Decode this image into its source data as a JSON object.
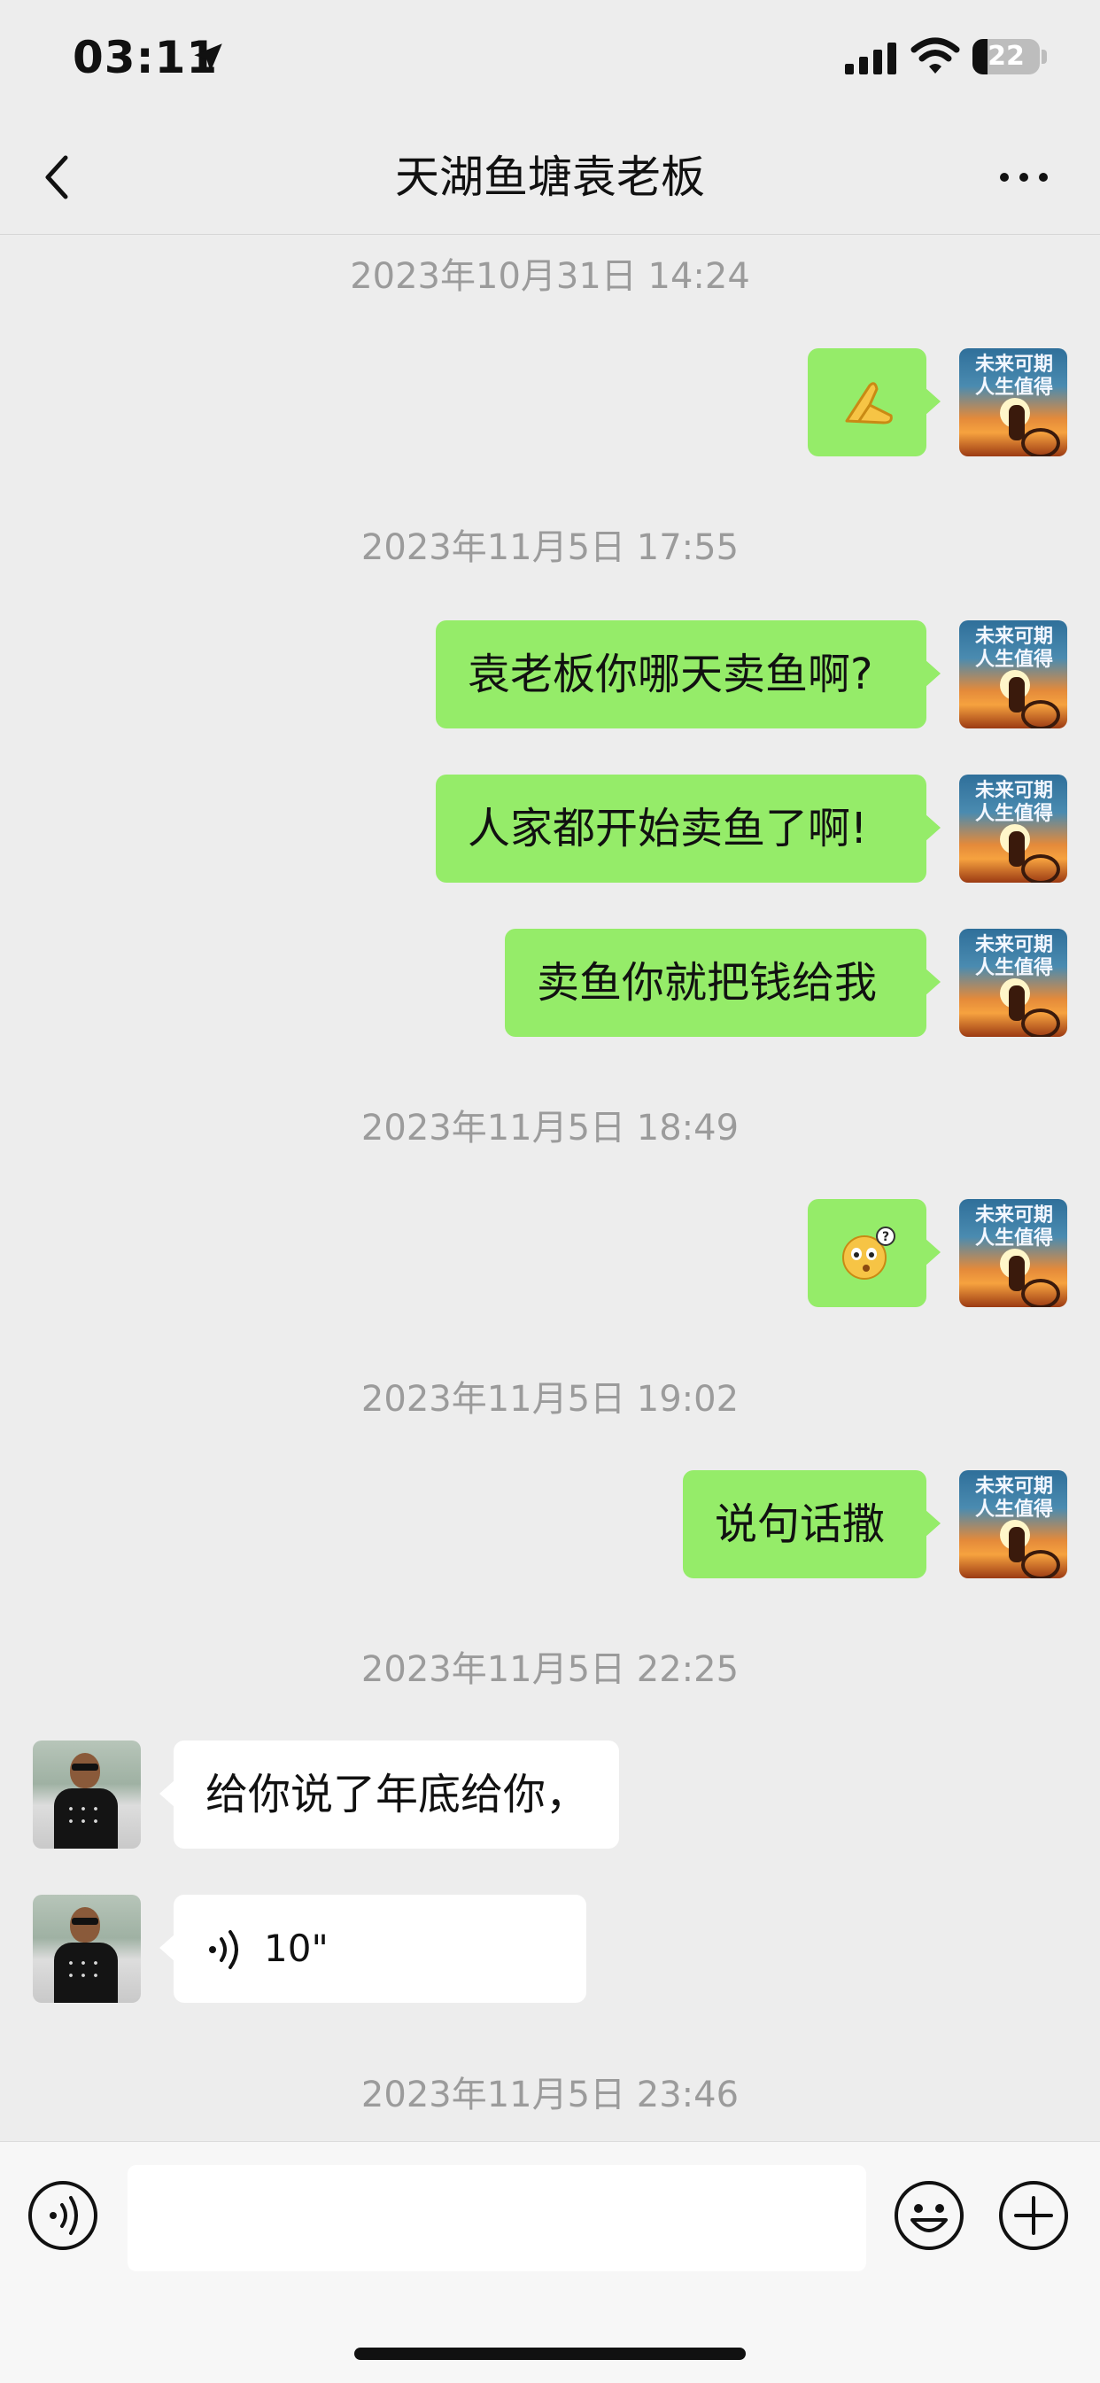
{
  "status_bar": {
    "time": "03:11",
    "battery": "22",
    "battery_level": 0.22
  },
  "nav": {
    "title": "天湖鱼塘袁老板"
  },
  "timestamps": [
    "2023年10月31日 14:24",
    "2023年11月5日 17:55",
    "2023年11月5日 18:49",
    "2023年11月5日 19:02",
    "2023年11月5日 22:25",
    "2023年11月5日 23:46"
  ],
  "messages": [
    {
      "from": "me",
      "type": "emoji",
      "icon": "folded-hands-emoji-icon"
    },
    {
      "from": "me",
      "type": "text",
      "text": "袁老板你哪天卖鱼啊?"
    },
    {
      "from": "me",
      "type": "text",
      "text": "人家都开始卖鱼了啊!"
    },
    {
      "from": "me",
      "type": "text",
      "text": "卖鱼你就把钱给我"
    },
    {
      "from": "me",
      "type": "emoji",
      "icon": "confused-face-emoji-icon"
    },
    {
      "from": "me",
      "type": "text",
      "text": "说句话撒"
    },
    {
      "from": "other",
      "type": "text",
      "text": "给你说了年底给你，"
    },
    {
      "from": "other",
      "type": "voice",
      "duration": "10\""
    }
  ],
  "avatars": {
    "me_text": "未来可期 人生值得"
  },
  "input": {
    "placeholder": ""
  },
  "colors": {
    "my_bubble": "#95ec69",
    "other_bubble": "#ffffff",
    "background": "#ededed"
  }
}
